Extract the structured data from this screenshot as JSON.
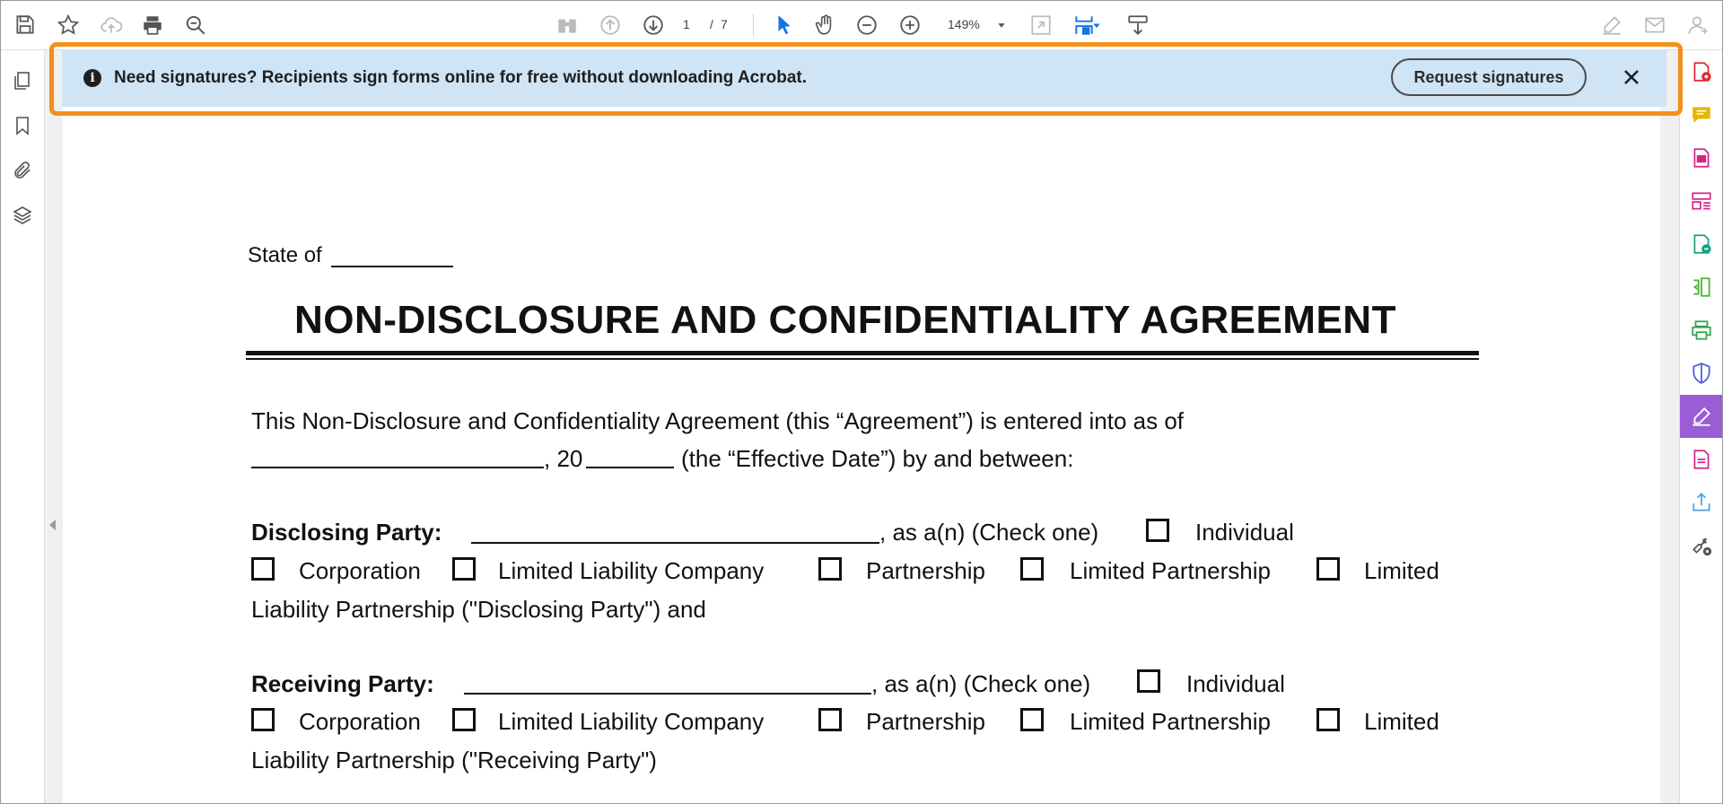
{
  "toolbar": {
    "page_current": "1",
    "page_sep": "/",
    "page_total": "7",
    "zoom": "149%"
  },
  "banner": {
    "message": "Need signatures? Recipients sign forms online for free without downloading Acrobat.",
    "request_button": "Request signatures",
    "info_glyph": "i",
    "highlight_color": "#f3901c",
    "background_color": "#cfe4f5"
  },
  "document": {
    "state_label": "State of",
    "title": "NON-DISCLOSURE AND CONFIDENTIALITY AGREEMENT",
    "intro_line1": "This Non-Disclosure and Confidentiality Agreement (this “Agreement”) is entered into as of",
    "intro_line2_year_prefix": ", 20",
    "intro_line2_suffix": "(the “Effective Date”) by and between:",
    "disclosing": {
      "label": "Disclosing Party:",
      "as_text": ", as a(n) (Check one)",
      "individual": "Individual",
      "corporation": "Corporation",
      "llc": "Limited Liability Company",
      "partnership": "Partnership",
      "lp": "Limited Partnership",
      "limited": "Limited",
      "closing": "Liability Partnership (\"Disclosing Party\") and"
    },
    "receiving": {
      "label": "Receiving Party:",
      "as_text": ", as a(n) (Check one)",
      "individual": "Individual",
      "corporation": "Corporation",
      "llc": "Limited Liability Company",
      "partnership": "Partnership",
      "lp": "Limited Partnership",
      "limited": "Limited",
      "closing": "Liability Partnership (\"Receiving Party\")"
    }
  },
  "colors": {
    "accent_blue": "#1473e6",
    "active_tool": "#9a5dd6"
  }
}
